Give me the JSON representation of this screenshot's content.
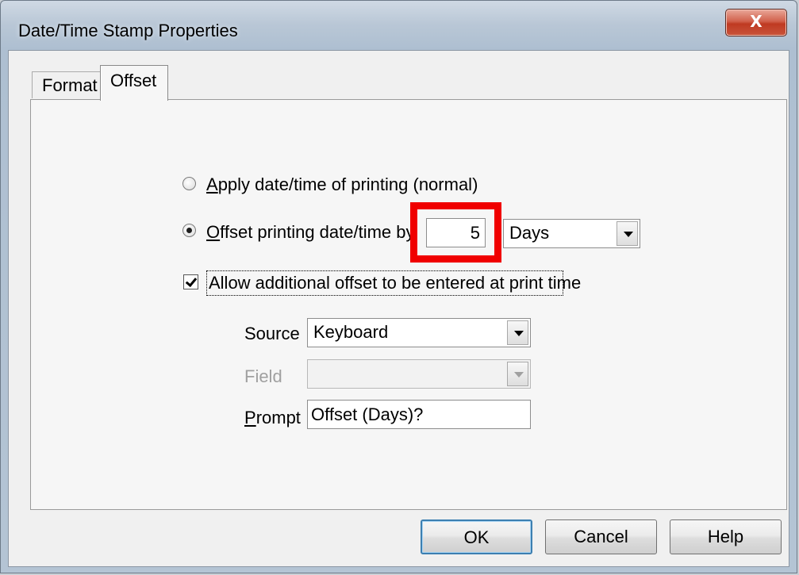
{
  "window": {
    "title": "Date/Time Stamp Properties",
    "close_glyph": "X"
  },
  "tabs": [
    {
      "label": "Format",
      "selected": false
    },
    {
      "label": "Offset",
      "selected": true
    }
  ],
  "offset_panel": {
    "radio_normal": {
      "label": "Apply date/time of printing (normal)",
      "checked": false
    },
    "radio_offset": {
      "label": "Offset printing date/time by",
      "checked": true
    },
    "offset_value": "5",
    "offset_unit": "Days",
    "allow_checkbox": {
      "label": "Allow additional offset to be entered at print time",
      "checked": true
    },
    "source": {
      "label": "Source",
      "value": "Keyboard"
    },
    "field": {
      "label": "Field",
      "value": "",
      "disabled": true
    },
    "prompt": {
      "label": "Prompt",
      "value": "Offset (Days)?"
    }
  },
  "buttons": {
    "ok": "OK",
    "cancel": "Cancel",
    "help": "Help"
  },
  "colors": {
    "highlight": "#f00000",
    "close_button": "#c9543b"
  }
}
